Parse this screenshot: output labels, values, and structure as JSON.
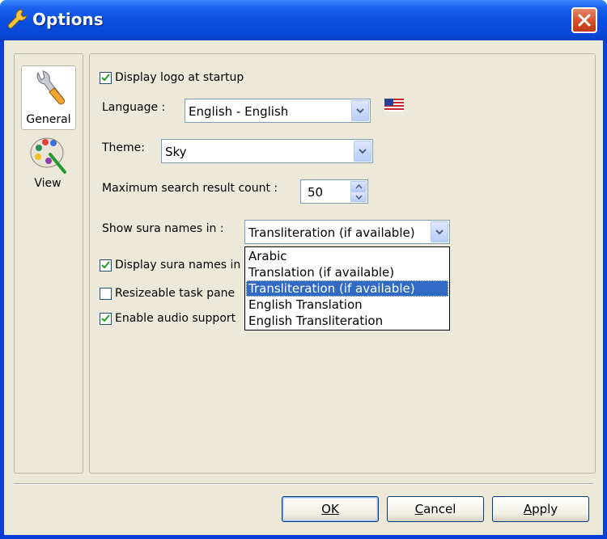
{
  "window": {
    "title": "Options"
  },
  "nav": {
    "items": [
      {
        "label": "General",
        "selected": true,
        "icon": "wrench-icon"
      },
      {
        "label": "View",
        "selected": false,
        "icon": "palette-icon"
      }
    ]
  },
  "general": {
    "display_logo": {
      "label": "Display logo at startup",
      "checked": true
    },
    "language": {
      "label": "Language :",
      "value": "English - English",
      "flag_icon": "us-flag-icon"
    },
    "theme": {
      "label": "Theme:",
      "value": "Sky"
    },
    "max_results": {
      "label": "Maximum search result count :",
      "value": "50"
    },
    "sura_names": {
      "label": "Show sura names in :",
      "value": "Transliteration (if available)",
      "options": [
        "Arabic",
        "Translation (if available)",
        "Transliteration (if available)",
        "English Translation",
        "English Transliteration"
      ],
      "selected_index": 2
    },
    "display_sura_names": {
      "label": "Display sura names in",
      "checked": true
    },
    "resizeable_task_pane": {
      "label": "Resizeable task pane",
      "checked": false
    },
    "enable_audio": {
      "label": "Enable audio support",
      "checked": true
    }
  },
  "buttons": {
    "ok": {
      "label": "OK",
      "accel": "O"
    },
    "cancel": {
      "label": "Cancel",
      "accel": "C"
    },
    "apply": {
      "label": "Apply",
      "accel": "A"
    }
  },
  "colors": {
    "titlebar": "#0a47d6",
    "dialog_bg": "#ece9d8",
    "selection": "#316ac5",
    "check": "#21a121",
    "close_button": "#d24b26"
  }
}
